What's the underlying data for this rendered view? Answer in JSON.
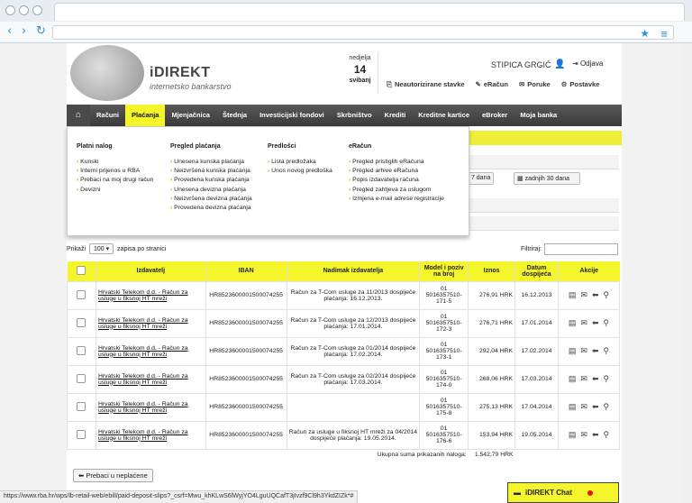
{
  "browser": {
    "url": ""
  },
  "header": {
    "logo": "iDIREKT",
    "logo_sub": "internetsko bankarstvo",
    "day_name": "nedjelja",
    "day_num": "14",
    "month": "svibanj",
    "user": "STIPICA GRGIĆ",
    "logout": "Odjava",
    "links": [
      "Neautorizirane stavke",
      "eRačun",
      "Poruke",
      "Postavke"
    ]
  },
  "nav": [
    "Računi",
    "Plaćanja",
    "Mjenjačnica",
    "Štednja",
    "Investicijski fondovi",
    "Skrbništvo",
    "Krediti",
    "Kreditne kartice",
    "eBroker",
    "Moja banka"
  ],
  "dropdown": {
    "platni": {
      "title": "Platni nalog",
      "items": [
        "Kunski",
        "Interni prijenos u RBA",
        "Prebaci na moj drugi račun",
        "Devizni"
      ]
    },
    "pregled": {
      "title": "Pregled plaćanja",
      "items": [
        "Unesena kunska plaćanja",
        "Neizvršena kunska plaćanja",
        "Provedena kunska plaćanja",
        "Unesena devizna plaćanja",
        "Neizvršena devizna plaćanja",
        "Provedena devizna plaćanja"
      ]
    },
    "predlosci": {
      "title": "Predlošci",
      "items": [
        "Lista predložaka",
        "Unos novog predloška"
      ]
    },
    "eracun": {
      "title": "eRačun",
      "items": [
        "Pregled pristiglih eRačuna",
        "Pregled arhive eRačuna",
        "Popis izdavatelja računa",
        "Pregled zahtjeva za uslugom",
        "Izmjena e-mail adrese registracije"
      ]
    }
  },
  "bg_buttons": [
    "nji 7 dana",
    "zadnjih 30 dana"
  ],
  "controls": {
    "prikazi": "Prikaži",
    "count": "100",
    "zapisa": "zapisa po stranici",
    "filtriraj": "Filtriraj:"
  },
  "table": {
    "headers": [
      "Izdavatelj",
      "IBAN",
      "Nadimak izdavatelja",
      "Model i poziv na broj",
      "Iznos",
      "Datum dospijeća",
      "Akcije"
    ],
    "rows": [
      {
        "izd": "Hrvatski Telekom d.d. - Račun za usluge u fiksnoj HT mreži",
        "iban": "HR8523600001500074255",
        "nad": "Račun za T-Com usluge za 11/2013 dospijeće plaćanja: 16.12.2013.",
        "model": "01 5016357510-171-5",
        "iznos": "276,91 HRK",
        "datum": "16.12.2013"
      },
      {
        "izd": "Hrvatski Telekom d.d. - Račun za usluge u fiksnoj HT mreži",
        "iban": "HR8523600001500074255",
        "nad": "Račun za T-Com usluge za 12/2013 dospijeće plaćanja: 17.01.2014.",
        "model": "01 5016357510-172-3",
        "iznos": "276,71 HRK",
        "datum": "17.01.2014"
      },
      {
        "izd": "Hrvatski Telekom d.d. - Račun za usluge u fiksnoj HT mreži",
        "iban": "HR8523600001500074255",
        "nad": "Račun za T-Com usluge za 01/2014 dospijeće plaćanja: 17.02.2014.",
        "model": "01 5016357510-173-1",
        "iznos": "292,04 HRK",
        "datum": "17.02.2014"
      },
      {
        "izd": "Hrvatski Telekom d.d. - Račun za usluge u fiksnoj HT mreži",
        "iban": "HR8523600001500074255",
        "nad": "Račun za T-Com usluge za 02/2014 dospijeće plaćanja: 17.03.2014.",
        "model": "01 5016357510-174-0",
        "iznos": "268,06 HRK",
        "datum": "17.03.2014"
      },
      {
        "izd": "Hrvatski Telekom d.d. - Račun za usluge u fiksnoj HT mreži",
        "iban": "HR8523600001500074255",
        "nad": "",
        "model": "01 5016357510-175-8",
        "iznos": "275,13 HRK",
        "datum": "17.04.2014"
      },
      {
        "izd": "Hrvatski Telekom d.d. - Račun za usluge u fiksnoj HT mreži",
        "iban": "HR8523600001500074255",
        "nad": "Račun za usluge u fiksnoj HT mreži za 04/2014 dospijeće plaćanja: 19.05.2014.",
        "model": "01 5016357510-176-6",
        "iznos": "153,94 HRK",
        "datum": "19.05.2014"
      }
    ],
    "sum_label": "Ukupna suma prikazanih naloga:",
    "sum_value": "1.542,79 HRK"
  },
  "prebaci": "Prebaci u neplaćene",
  "status_url": "https://www.rba.hr/wps/lb-retail-web/ebill/paid-deposit-slips?_csrf=Mwu_khKLwS6lWyjYO4LguUQCafT3jIvzf9Cl9h3YkdZIZk*#",
  "chat": "iDIREKT Chat"
}
